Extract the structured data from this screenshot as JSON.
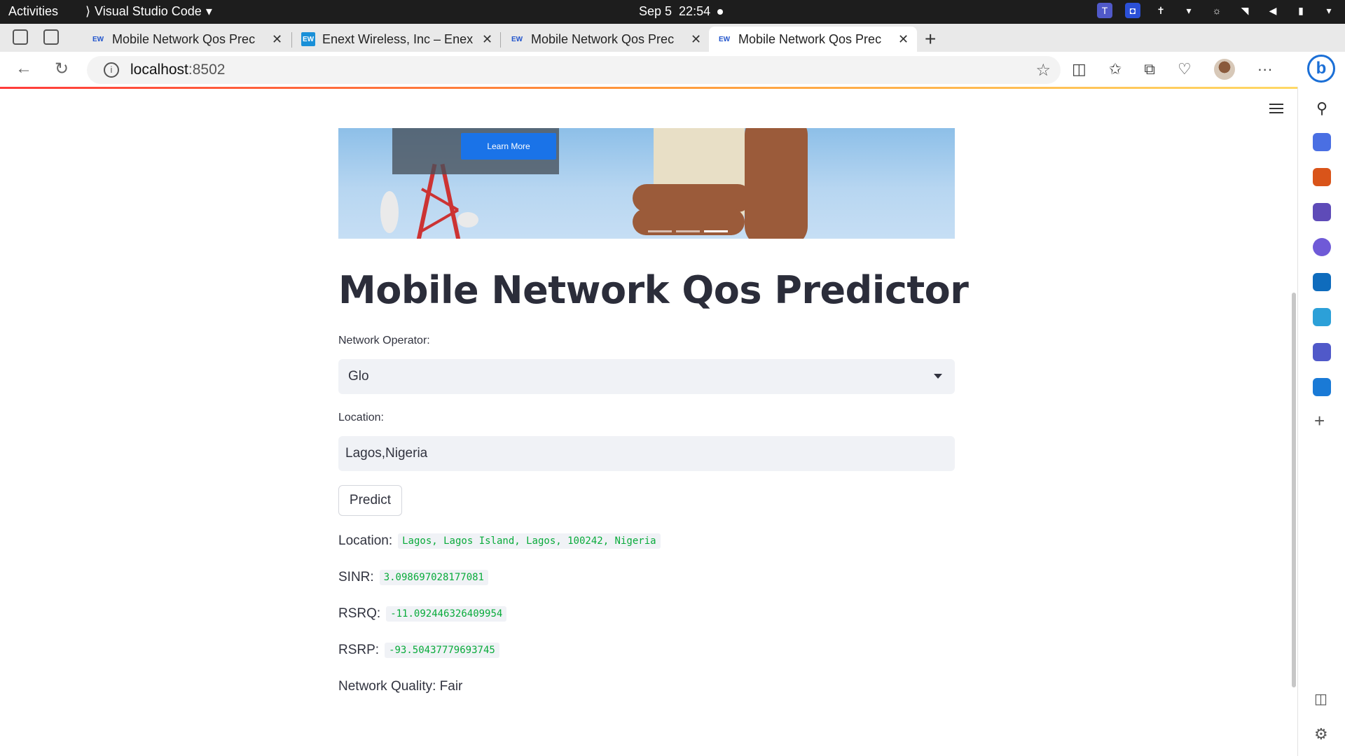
{
  "system_bar": {
    "activities": "Activities",
    "app_name": "Visual Studio Code",
    "date": "Sep 5",
    "time": "22:54"
  },
  "tabs": [
    {
      "title": "Mobile Network Qos Prec",
      "favicon": "EW"
    },
    {
      "title": "Enext Wireless, Inc – Enex",
      "favicon": "EW"
    },
    {
      "title": "Mobile Network Qos Prec",
      "favicon": "EW"
    },
    {
      "title": "Mobile Network Qos Prec",
      "favicon": "EW"
    }
  ],
  "address_bar": {
    "host": "localhost",
    "port": ":8502"
  },
  "banner": {
    "button_label": "Learn More"
  },
  "page": {
    "title": "Mobile Network Qos Predictor",
    "operator_label": "Network Operator:",
    "operator_value": "Glo",
    "location_label": "Location:",
    "location_value": "Lagos,Nigeria",
    "predict_button": "Predict"
  },
  "results": {
    "location_label": "Location:",
    "location_value": "Lagos, Lagos Island, Lagos, 100242, Nigeria",
    "sinr_label": "SINR:",
    "sinr_value": "3.098697028177081",
    "rsrq_label": "RSRQ:",
    "rsrq_value": "-11.092446326409954",
    "rsrp_label": "RSRP:",
    "rsrp_value": "-93.50437779693745",
    "quality_text": "Network Quality: Fair"
  },
  "colors": {
    "accent": "#ff4b4b",
    "code_green": "#09ab3b",
    "input_bg": "#f0f2f6"
  }
}
